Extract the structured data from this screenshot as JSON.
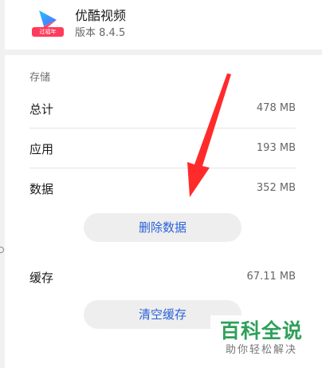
{
  "app": {
    "name": "优酷视频",
    "version": "版本 8.4.5",
    "badge": "过福年"
  },
  "storage": {
    "section_title": "存储",
    "rows": [
      {
        "label": "总计",
        "value": "478 MB"
      },
      {
        "label": "应用",
        "value": "193 MB"
      },
      {
        "label": "数据",
        "value": "352 MB"
      }
    ],
    "clear_data_button": "删除数据"
  },
  "cache": {
    "label": "缓存",
    "value": "67.11 MB",
    "clear_cache_button": "清空缓存"
  },
  "watermark": {
    "title": "百科全说",
    "subtitle": "助你轻松解决"
  },
  "colors": {
    "accent": "#2a62d8",
    "annotation_arrow": "#ff2b2b",
    "watermark_green": "#2fa05a"
  }
}
